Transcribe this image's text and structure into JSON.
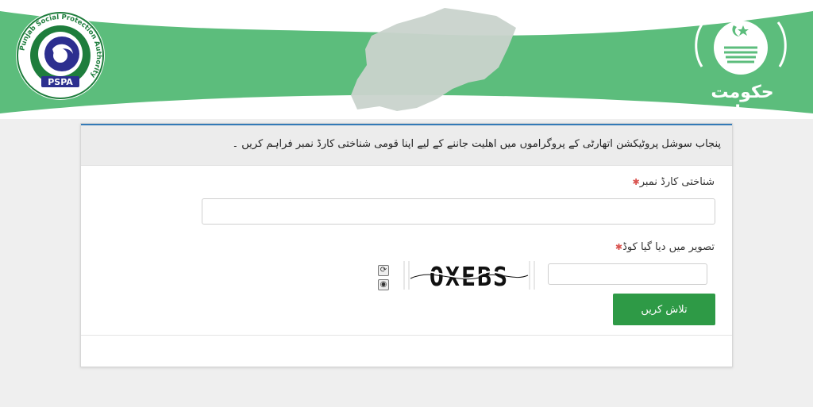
{
  "colors": {
    "banner_green": "#5cbd7c",
    "button_green": "#2e9a46",
    "accent_blue": "#337ab7",
    "required_red": "#d9534f"
  },
  "header": {
    "left_logo": {
      "ring_text": "Punjab Social Protection Authority",
      "acronym": "PSPA",
      "icon": "pspa-logo-icon"
    },
    "right_logo": {
      "caption": "حکومت پنجاب",
      "icon": "punjab-government-emblem-icon"
    },
    "map_icon": "punjab-map-icon"
  },
  "form": {
    "instruction": "پنجاب سوشل پروٹیکشن اتھارٹی کے پروگراموں میں اھلیت جاننے کے لیے اپنا قومی شناختی کارڈ نمبر فراہم کریں ۔",
    "cnic_label": "شناختی کارڈ نمبر",
    "cnic_value": "",
    "captcha_label": "تصویر میں دیا گیا کوڈ",
    "captcha_value": "",
    "captcha_text": "OXEBS",
    "refresh_icon": "refresh-icon",
    "audio_icon": "audio-icon",
    "search_button": "تلاش کریں"
  }
}
